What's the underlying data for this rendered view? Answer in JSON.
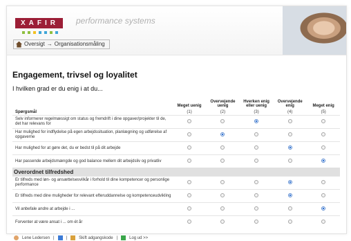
{
  "brand": {
    "logo": "XAFIR",
    "tagline": "performance systems",
    "colors": {
      "logo_bg": "#9c1e36",
      "dot1": "#8fbf3f",
      "dot2": "#f3c121",
      "dot3": "#3fa6d8"
    }
  },
  "breadcrumb": {
    "items": [
      "Oversigt",
      "Organisationsmåling"
    ],
    "separator": "→"
  },
  "page": {
    "title": "Engagement, trivsel og loyalitet",
    "question": "I hvilken grad er du enig i at du..."
  },
  "table": {
    "question_header": "Spørgsmål",
    "columns": [
      {
        "label": "Meget uenig",
        "num": "(1)"
      },
      {
        "label": "Overvejende uenig",
        "num": "(2)"
      },
      {
        "label": "Hverken enig eller uenig",
        "num": "(3)"
      },
      {
        "label": "Overvejende enig",
        "num": "(4)"
      },
      {
        "label": "Meget enig",
        "num": "(5)"
      }
    ],
    "rows": [
      {
        "text": "Selv informerer regelmæssigt om status og fremdrift i dine opgaver/projekter til de, det har relevans for",
        "selected": 3
      },
      {
        "text": "Har mulighed for indflydelse på egen arbejdssituation, planlægning og udførelse af opgaverne",
        "selected": 2
      },
      {
        "text": "Har mulighed for at gøre det, du er bedst til på dit arbejde",
        "selected": 4
      },
      {
        "text": "Har passende arbejdsmængde og god balance mellem dit arbejdsliv og privatliv",
        "selected": 5
      }
    ],
    "section_title": "Overordnet tilfredshed",
    "rows2": [
      {
        "text": "Er tilfreds med løn- og ansættelsesvilkår i forhold til dine kompetencer og personlige performance",
        "selected": 4
      },
      {
        "text": "Er tilfreds med dine muligheder for relevant efteruddannelse og kompetenceudvikling",
        "selected": 4
      },
      {
        "text": "Vil anbefale andre at arbejde i ...",
        "selected": 5
      },
      {
        "text": "Forventer at være ansat i ... om ét år",
        "selected": 0
      }
    ]
  },
  "footer": {
    "user": "Lene Ledersen",
    "change_password": "Skift adgangskode",
    "logout": "Log ud >>"
  }
}
